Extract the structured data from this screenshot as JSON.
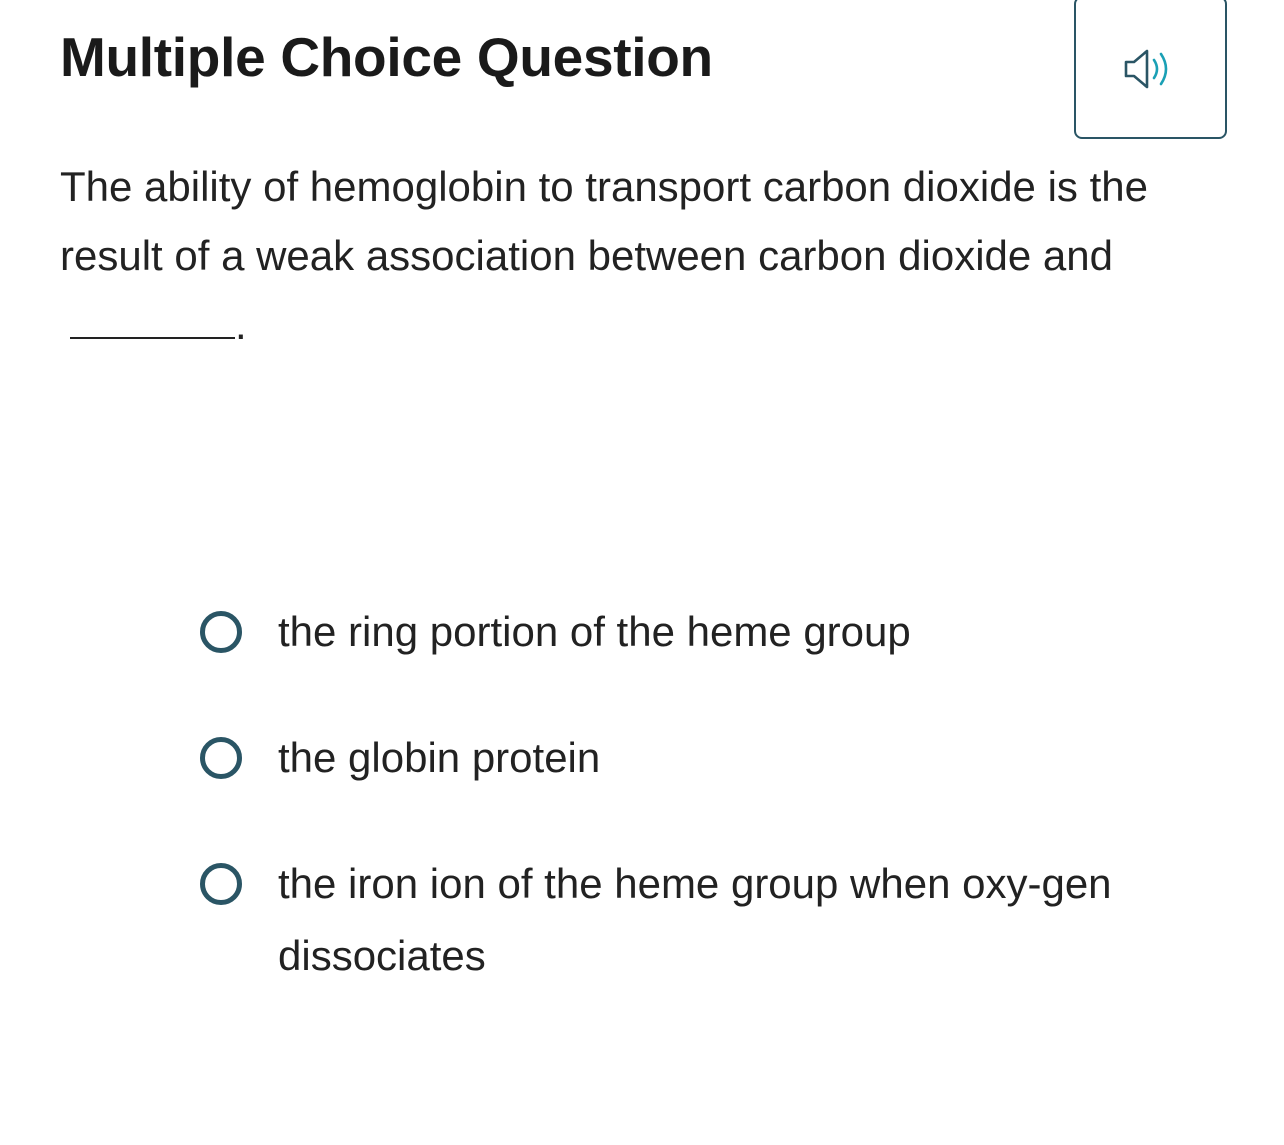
{
  "header": {
    "title": "Multiple Choice Question",
    "audio_icon": "speaker-icon"
  },
  "question": {
    "prompt": "The ability of hemoglobin to transport carbon dioxide is the result of a weak association between carbon dioxide and",
    "suffix": "."
  },
  "options": [
    {
      "label": "the ring portion of the heme group"
    },
    {
      "label": "the globin protein"
    },
    {
      "label": "the iron ion of the heme group when oxy-gen dissociates"
    }
  ],
  "colors": {
    "accent": "#2a5565",
    "sound_waves": "#1aa0b5",
    "text": "#222222"
  }
}
